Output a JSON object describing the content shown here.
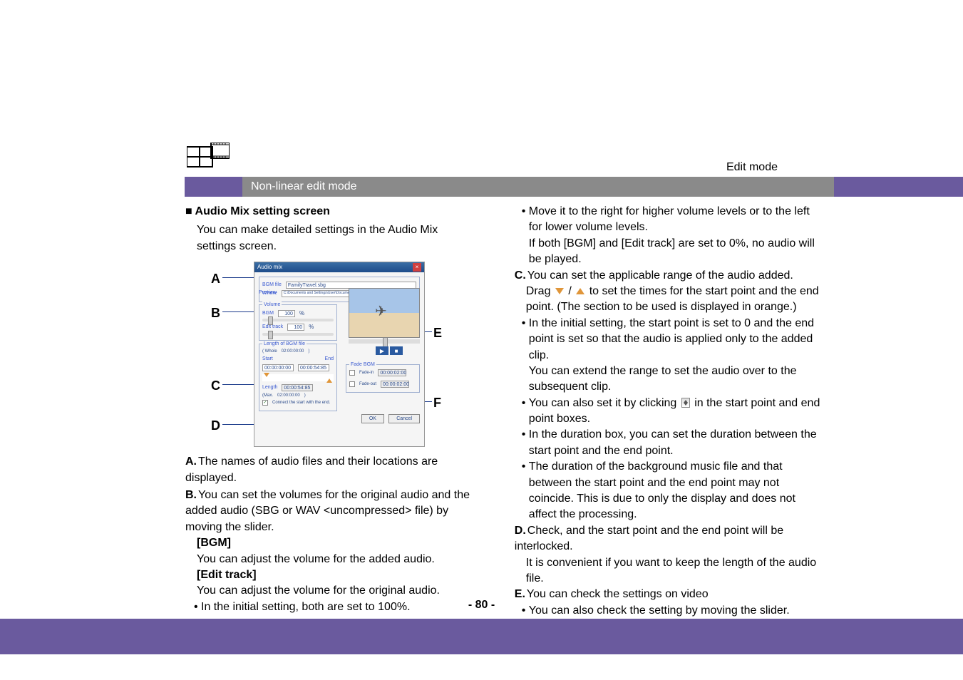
{
  "header": {
    "mode_label": "Edit mode",
    "subheader": "Non-linear edit mode"
  },
  "section_title": "Audio Mix setting screen",
  "intro_text": "You can make detailed settings in the Audio Mix settings screen.",
  "letters": {
    "A": "A",
    "B": "B",
    "C": "C",
    "D": "D",
    "E": "E",
    "F": "F"
  },
  "dialog": {
    "title": "Audio mix",
    "close": "×",
    "bgm_file_label": "BGM file",
    "bgm_file_value": "FamilyTravel.sbg",
    "where_label": "Where",
    "where_value": "C:\\Documents and Settings\\User\\Documents\\My Pictures\\Motion\\SD STUDIO",
    "volume_label": "Volume",
    "preview_label": "Preview",
    "bgm_label": "BGM",
    "bgm_value": "100",
    "percent": "%",
    "edit_track_label": "Edit track",
    "edit_track_value": "100",
    "length_label": "Length of BGM file",
    "whole_label": "( Whole",
    "whole_value": "02:00:00:00",
    "end_paren": ")",
    "start_label": "Start",
    "end_label": "End",
    "start_value": "00:00:00:00",
    "end_value": "00:00:54:85",
    "length2_label": "Length",
    "length2_value": "00:00:54:85",
    "max_label": "(Max.",
    "max_value": "02:00:00:00",
    "connect_label": "Connect the start with the end.",
    "fade_bgm_label": "Fade BGM",
    "fadein_label": "Fade-in",
    "fadein_value": "00:00:02:00",
    "fadeout_label": "Fade-out",
    "fadeout_value": "00:00:02:00",
    "ok": "OK",
    "cancel": "Cancel"
  },
  "left": {
    "A_text": "The names of audio files and their locations are displayed.",
    "B_text": "You can set the volumes for the original audio and the added audio (SBG or WAV <uncompressed> file) by moving the slider.",
    "BGM_heading": "[BGM]",
    "BGM_text": "You can adjust the volume for the added audio.",
    "Edit_heading": "[Edit track]",
    "Edit_text": "You can adjust the volume for the original audio.",
    "B_bullet": "In the initial setting, both are set to 100%."
  },
  "right": {
    "pre_bullet1": "Move it to the right for higher volume levels or to the left for lower volume levels.",
    "pre_note": "If both [BGM] and [Edit track] are set to 0%, no audio will be played.",
    "C_text1": "You can set the applicable range of the audio added.",
    "C_text2a": "Drag ",
    "C_text2b": " to set the times for the start point and the end point. (The section to be used is displayed in orange.)",
    "C_bullet1": "In the initial setting, the start point is set to 0 and the end point is set so that the audio is applied only to the added clip.",
    "C_bullet1_note": "You can extend the range to set the audio over to the subsequent clip.",
    "C_bullet2a": "You can also set it by clicking ",
    "C_bullet2b": " in the start point and end point boxes.",
    "C_bullet3": "In the duration box, you can set the duration between the start point and the end point.",
    "C_bullet4": "The duration of the background music file and that between the start point and the end point may not coincide. This is due to only the display and does not affect the processing.",
    "D_text": "Check, and the start point and the end point will be interlocked.",
    "D_note": "It is convenient if you want to keep the length of the audio file.",
    "E_text": "You can check the settings on video",
    "E_bullet": "You can also check the setting by moving the slider."
  },
  "slash": " / ",
  "page_number": "- 80 -"
}
